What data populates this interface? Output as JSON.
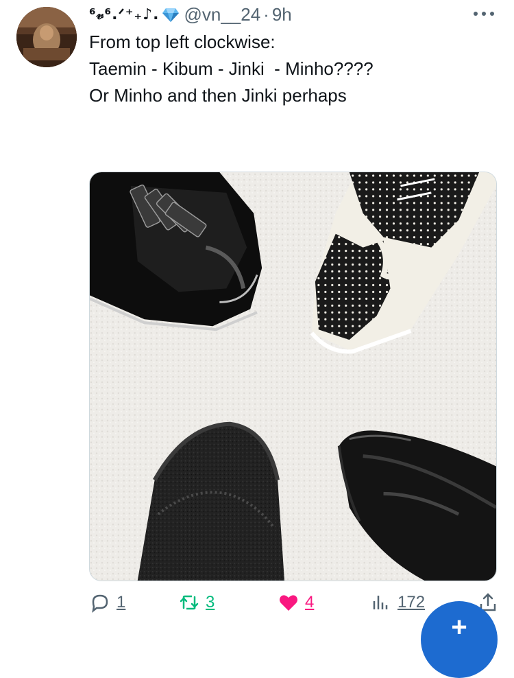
{
  "tweet": {
    "display_name": "⁶𝓋⁶.ᐟ⁺₊♪.",
    "handle": "@vn__24",
    "separator": "·",
    "time": "9h",
    "text_lines": [
      "From top left clockwise:",
      "",
      "Taemin - Kibum - Jinki  - Minho????",
      "",
      "Or Minho and then Jinki perhaps"
    ],
    "media": {
      "alt_subject": "four shoes on white fur rug"
    }
  },
  "actions": {
    "reply_count": "1",
    "retweet_count": "3",
    "like_count": "4",
    "views_count": "172"
  },
  "colors": {
    "text": "#0f1419",
    "secondary": "#536471",
    "retweet": "#00ba7c",
    "like": "#f91880",
    "fab": "#1d6bd0"
  },
  "icons": {
    "more": "more-horizontal-icon",
    "reply": "reply-icon",
    "retweet": "retweet-icon",
    "like": "heart-icon",
    "views": "views-bar-chart-icon",
    "share": "share-icon",
    "gem": "gem-icon",
    "compose": "plus-icon"
  },
  "fab": {
    "label": "+"
  }
}
